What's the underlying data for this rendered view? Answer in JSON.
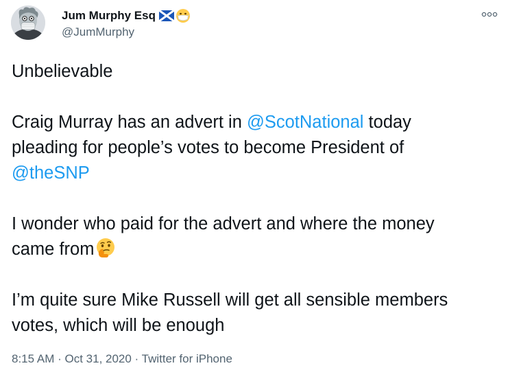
{
  "author": {
    "display_name": "Jum Murphy Esq",
    "handle": "@JumMurphy",
    "badges": [
      "scotland-flag-icon",
      "face-with-mask-icon"
    ],
    "avatar": "avatar-masked-figure"
  },
  "tweet": {
    "p1": "Unbelievable",
    "p2_a": "Craig Murray has an advert in ",
    "p2_mention1": "@ScotNational",
    "p2_b": " today",
    "p2_c": "pleading for people’s votes to become President of",
    "p2_mention2": "@theSNP",
    "p3_a": "I wonder who paid for the advert and where the money",
    "p3_b": "came from",
    "p3_emoji": "thinking-face-icon",
    "p4_a": "I’m quite sure Mike Russell will get all sensible members",
    "p4_b": "votes, which will be enough"
  },
  "meta": {
    "time": "8:15 AM",
    "sep1": " · ",
    "date": "Oct 31, 2020",
    "sep2": " · ",
    "source": "Twitter for iPhone"
  },
  "colors": {
    "text": "#0f1419",
    "secondary": "#536471",
    "link": "#1d9bf0"
  },
  "icons": {
    "more": "more-horizontal-icon"
  }
}
